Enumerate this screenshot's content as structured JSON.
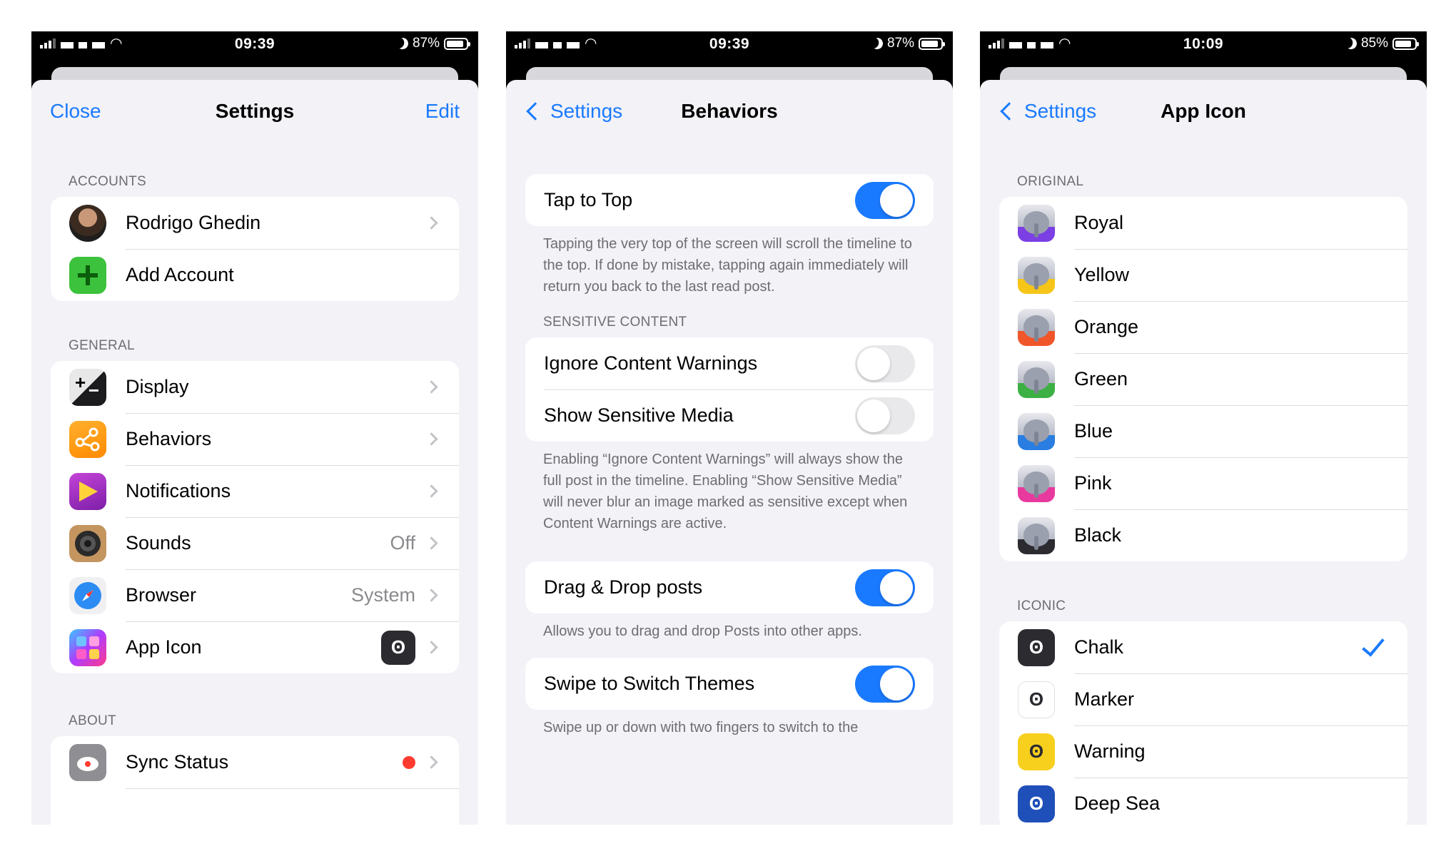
{
  "panels": [
    {
      "status": {
        "time": "09:39",
        "battery": "87%",
        "battery_level": 0.87
      },
      "nav": {
        "left": "Close",
        "title": "Settings",
        "right": "Edit"
      },
      "sections": {
        "accounts": {
          "header": "ACCOUNTS",
          "items": [
            {
              "label": "Rodrigo Ghedin",
              "icon": "avatar"
            },
            {
              "label": "Add Account",
              "icon": "plus-icon"
            }
          ]
        },
        "general": {
          "header": "GENERAL",
          "items": [
            {
              "label": "Display",
              "icon": "display-icon",
              "value": ""
            },
            {
              "label": "Behaviors",
              "icon": "behaviors-icon",
              "value": ""
            },
            {
              "label": "Notifications",
              "icon": "notifications-icon",
              "value": ""
            },
            {
              "label": "Sounds",
              "icon": "speaker-icon",
              "value": "Off"
            },
            {
              "label": "Browser",
              "icon": "compass-icon",
              "value": "System"
            },
            {
              "label": "App Icon",
              "icon": "app-grid-icon",
              "value": ""
            }
          ]
        },
        "about": {
          "header": "ABOUT",
          "items": [
            {
              "label": "Sync Status",
              "icon": "cloud-icon",
              "status_color": "#ff3b30"
            }
          ]
        }
      }
    },
    {
      "status": {
        "time": "09:39",
        "battery": "87%",
        "battery_level": 0.87
      },
      "nav": {
        "back": "Settings",
        "title": "Behaviors"
      },
      "tap_to_top": {
        "label": "Tap to Top",
        "on": true,
        "footer": "Tapping the very top of the screen will scroll the timeline to the top. If done by mistake, tapping again immediately will return you back to the last read post."
      },
      "sensitive": {
        "header": "SENSITIVE CONTENT",
        "items": [
          {
            "label": "Ignore Content Warnings",
            "on": false
          },
          {
            "label": "Show Sensitive Media",
            "on": false
          }
        ],
        "footer": "Enabling “Ignore Content Warnings” will always show the full post in the timeline. Enabling “Show Sensitive Media” will never blur an image marked as sensitive except when Content Warnings are active."
      },
      "drag_drop": {
        "label": "Drag & Drop posts",
        "on": true,
        "footer": "Allows you to drag and drop Posts into other apps."
      },
      "swipe_themes": {
        "label": "Swipe to Switch Themes",
        "on": true,
        "footer": "Swipe up or down with two fingers to switch to the"
      }
    },
    {
      "status": {
        "time": "10:09",
        "battery": "85%",
        "battery_level": 0.85
      },
      "nav": {
        "back": "Settings",
        "title": "App Icon"
      },
      "original": {
        "header": "ORIGINAL",
        "items": [
          {
            "label": "Royal",
            "color": "#7b3fe4"
          },
          {
            "label": "Yellow",
            "color": "#f5c518"
          },
          {
            "label": "Orange",
            "color": "#f0562a"
          },
          {
            "label": "Green",
            "color": "#3cb043"
          },
          {
            "label": "Blue",
            "color": "#2a7de1"
          },
          {
            "label": "Pink",
            "color": "#e83a9e"
          },
          {
            "label": "Black",
            "color": "#2b2b30"
          }
        ]
      },
      "iconic": {
        "header": "ICONIC",
        "selected": "Chalk",
        "items": [
          {
            "label": "Chalk",
            "color": "#2b2b30",
            "selected": true
          },
          {
            "label": "Marker",
            "color": "#ffffff",
            "selected": false
          },
          {
            "label": "Warning",
            "color": "#f7d01e",
            "selected": false
          },
          {
            "label": "Deep Sea",
            "color": "#1f4fb8",
            "selected": false
          }
        ]
      }
    }
  ]
}
